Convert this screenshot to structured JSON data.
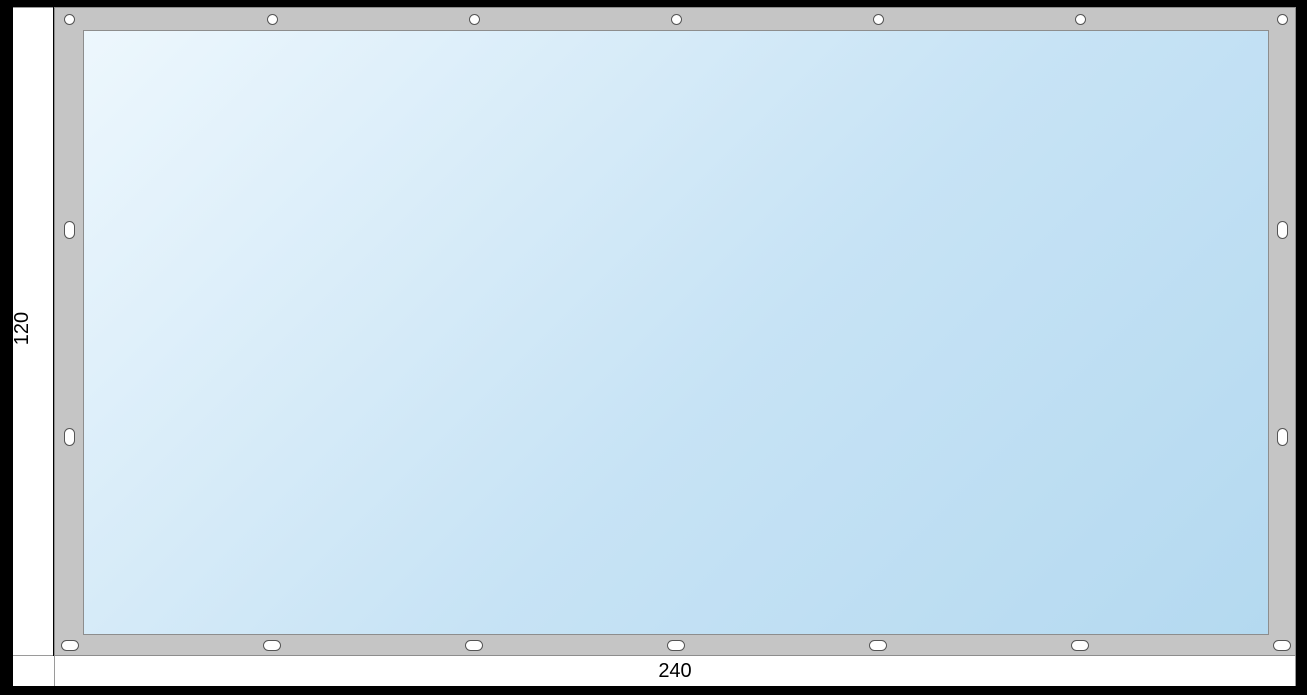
{
  "dimensions": {
    "height_label": "120",
    "width_label": "240"
  },
  "panel": {
    "frame_color": "#c5c5c5",
    "glass_gradient_from": "#edf7fd",
    "glass_gradient_to": "#b4d9f0"
  },
  "holes": {
    "top_row_count": 7,
    "top_row_shape": "small-circle",
    "bottom_row_count": 7,
    "bottom_row_shape": "horizontal-oval",
    "left_col_count": 2,
    "left_col_shape": "vertical-oval",
    "right_col_count": 2,
    "right_col_shape": "vertical-oval"
  }
}
